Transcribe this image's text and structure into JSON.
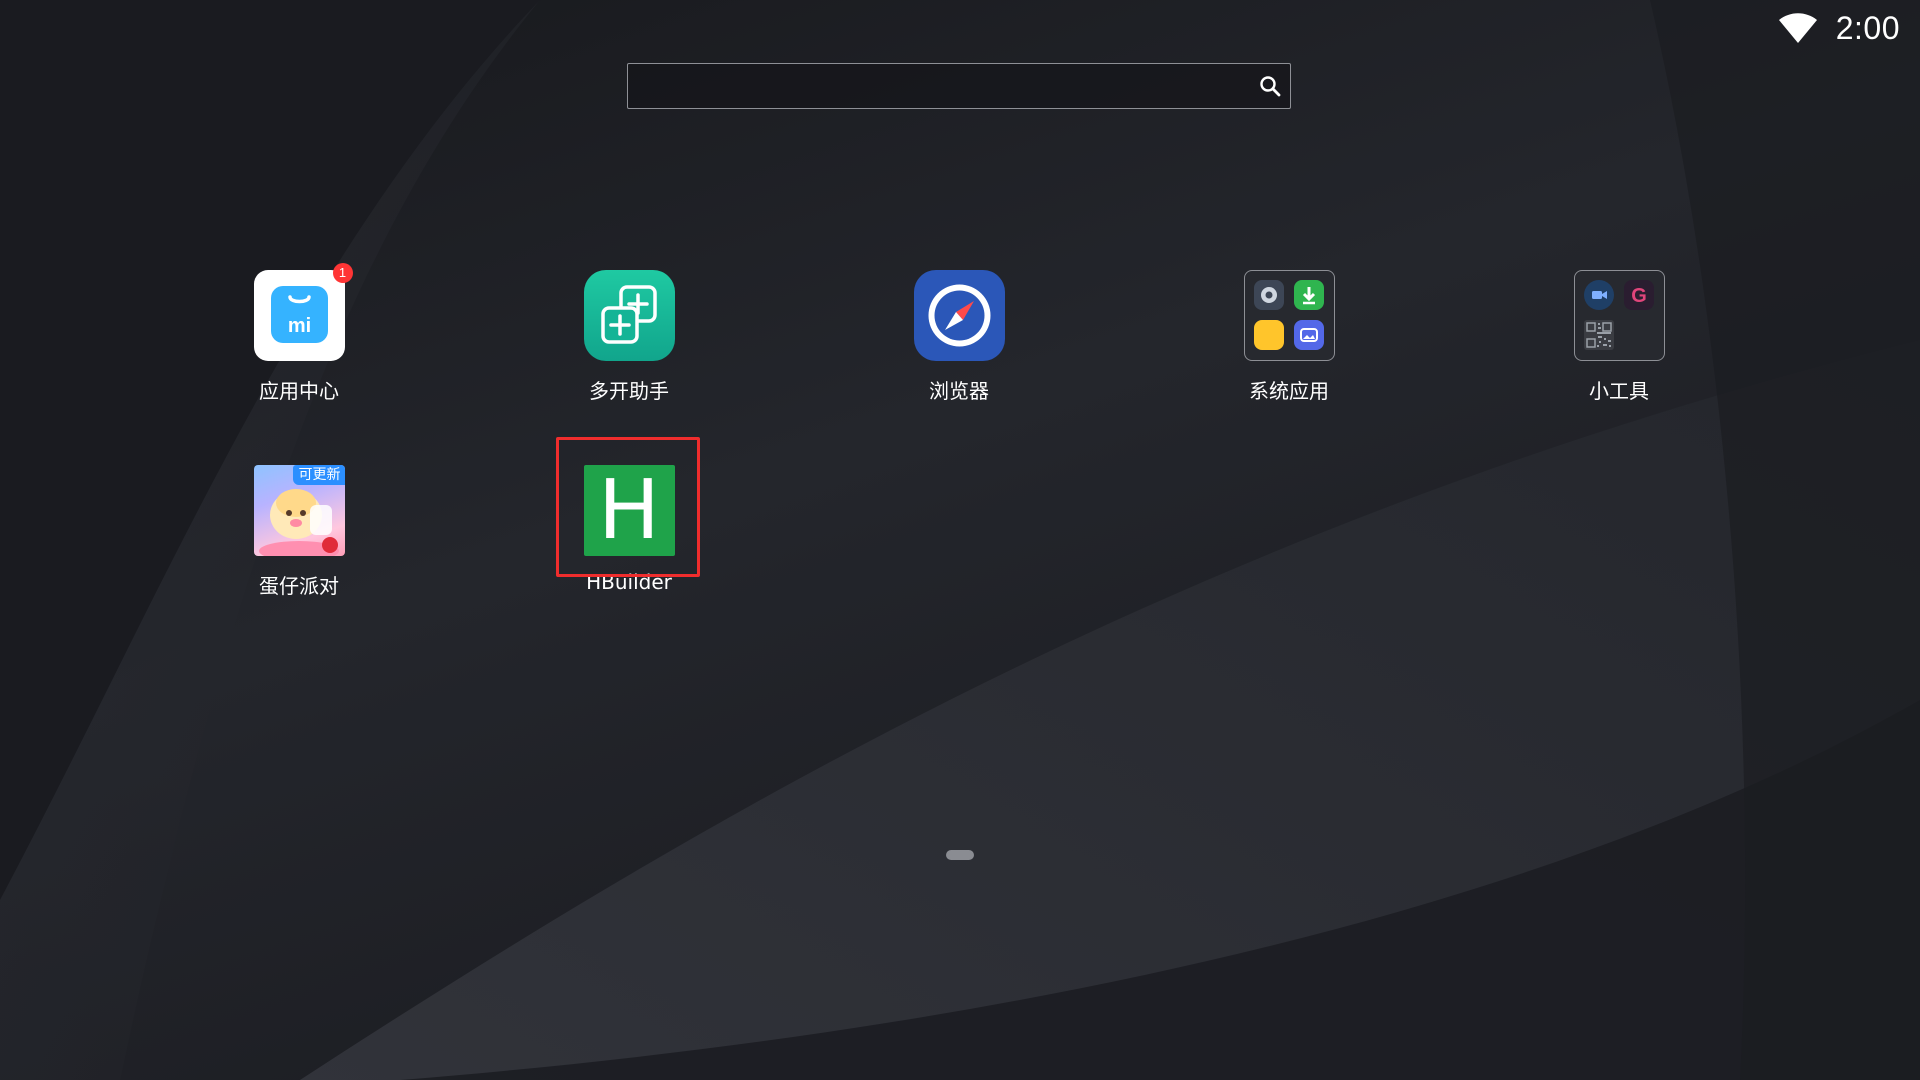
{
  "status_bar": {
    "time": "2:00",
    "wifi_icon": "wifi-icon"
  },
  "search": {
    "value": "",
    "placeholder": "",
    "icon": "search-icon"
  },
  "apps": [
    {
      "label": "应用中心",
      "icon": "mi-app-center-icon",
      "badge": "1"
    },
    {
      "label": "多开助手",
      "icon": "multi-open-icon"
    },
    {
      "label": "浏览器",
      "icon": "compass-browser-icon"
    },
    {
      "label": "系统应用",
      "icon": "system-apps-folder-icon"
    },
    {
      "label": "小工具",
      "icon": "tools-folder-icon"
    },
    {
      "label": "蛋仔派对",
      "icon": "eggy-party-icon",
      "badge": "可更新"
    },
    {
      "label": "HBuilder",
      "icon": "hbuilder-icon",
      "glyph": "H",
      "highlighted": true
    }
  ],
  "pages": {
    "current": 1,
    "total": 1
  },
  "colors": {
    "background": "#1e1f24",
    "highlight": "#f02d2d",
    "hbuilder_green": "#1fa34a",
    "multi_open_teal": "#1fc9a2",
    "browser_blue": "#2b57b8",
    "notification_red": "#ff3535",
    "update_blue": "#2b8fff"
  }
}
